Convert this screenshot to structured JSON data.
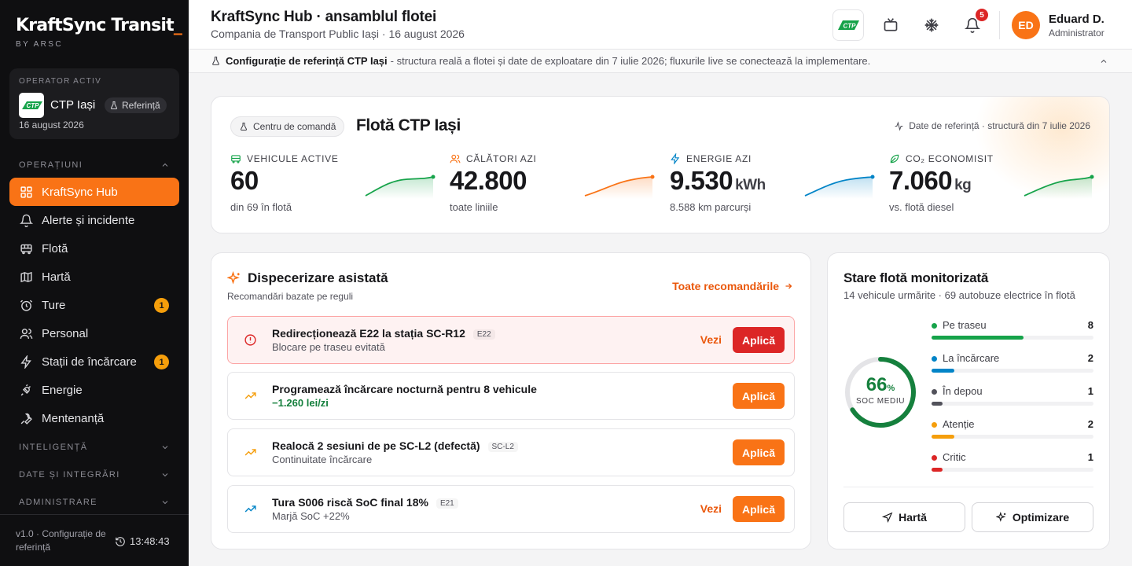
{
  "brand": {
    "title": "KraftSync Transit",
    "cursor": "_",
    "subtitle": "BY ARSC"
  },
  "operator": {
    "label": "OPERATOR ACTIV",
    "name": "CTP Iași",
    "badge": "Referință",
    "date": "16 august 2026"
  },
  "sidebar": {
    "section_ops": "OPERAȚIUNI",
    "items": [
      {
        "label": "KraftSync Hub",
        "icon": "grid-icon",
        "active": true
      },
      {
        "label": "Alerte și incidente",
        "icon": "bell-icon"
      },
      {
        "label": "Flotă",
        "icon": "bus-icon"
      },
      {
        "label": "Hartă",
        "icon": "map-icon"
      },
      {
        "label": "Ture",
        "icon": "clock-icon",
        "badge": "1"
      },
      {
        "label": "Personal",
        "icon": "users-icon"
      },
      {
        "label": "Stații de încărcare",
        "icon": "bolt-icon",
        "badge": "1"
      },
      {
        "label": "Energie",
        "icon": "plug-icon"
      },
      {
        "label": "Mentenanță",
        "icon": "wrench-icon"
      }
    ],
    "section_intel": "INTELIGENȚĂ",
    "section_data": "DATE ȘI INTEGRĂRI",
    "section_admin": "ADMINISTRARE",
    "footer_version": "v1.0 · Configurație de referință",
    "footer_time": "13:48:43"
  },
  "topbar": {
    "title": "KraftSync Hub · ansamblul flotei",
    "subtitle": "Compania de Transport Public Iași · 16 august 2026",
    "notifications": "5",
    "avatar_initials": "ED",
    "user_name": "Eduard D.",
    "user_role": "Administrator"
  },
  "banner": {
    "bold": "Configurație de referință CTP Iași",
    "text": "- structura reală a flotei și date de exploatare din 7 iulie 2026; fluxurile live se conectează la implementare."
  },
  "hero": {
    "pill": "Centru de comandă",
    "title": "Flotă CTP Iași",
    "date": "Date de referință · structură din 7 iulie 2026",
    "kpis": [
      {
        "label": "VEHICULE ACTIVE",
        "value": "60",
        "unit": "",
        "sub": "din 69 în flotă",
        "color": "#16a34a"
      },
      {
        "label": "CĂLĂTORI AZI",
        "value": "42.800",
        "unit": "",
        "sub": "toate liniile",
        "color": "#f97316"
      },
      {
        "label": "ENERGIE AZI",
        "value": "9.530",
        "unit": "kWh",
        "sub": "8.588 km parcurși",
        "color": "#0284c7"
      },
      {
        "label": "CO₂ ECONOMISIT",
        "value": "7.060",
        "unit": "kg",
        "sub": "vs. flotă diesel",
        "color": "#16a34a"
      }
    ]
  },
  "dispatch": {
    "title": "Dispecerizare asistată",
    "subtitle": "Recomandări bazate pe reguli",
    "link": "Toate recomandările",
    "items": [
      {
        "title": "Redirecționează E22 la stația SC-R12",
        "tag": "E22",
        "sub": "Blocare pe traseu evitată",
        "vezi": "Vezi",
        "button": "Aplică"
      },
      {
        "title": "Programează încărcare nocturnă pentru 8 vehicule",
        "tag": "",
        "sub": "−1.260 lei/zi",
        "vezi": "",
        "button": "Aplică"
      },
      {
        "title": "Realocă 2 sesiuni de pe SC-L2 (defectă)",
        "tag": "SC-L2",
        "sub": "Continuitate încărcare",
        "vezi": "",
        "button": "Aplică"
      },
      {
        "title": "Tura S006 riscă SoC final 18%",
        "tag": "E21",
        "sub": "Marjă SoC +22%",
        "vezi": "Vezi",
        "button": "Aplică"
      }
    ]
  },
  "fleet": {
    "title": "Stare flotă monitorizată",
    "subtitle": "14 vehicule urmărite · 69 autobuze electrice în flotă",
    "soc_value": "66",
    "soc_unit": "%",
    "soc_label": "SOC MEDIU",
    "soc_fraction": 0.66,
    "statuses": [
      {
        "label": "Pe traseu",
        "count": "8",
        "color": "#16a34a",
        "fraction": 0.57
      },
      {
        "label": "La încărcare",
        "count": "2",
        "color": "#0284c7",
        "fraction": 0.14
      },
      {
        "label": "În depou",
        "count": "1",
        "color": "#52525b",
        "fraction": 0.07
      },
      {
        "label": "Atenție",
        "count": "2",
        "color": "#f59e0b",
        "fraction": 0.14
      },
      {
        "label": "Critic",
        "count": "1",
        "color": "#dc2626",
        "fraction": 0.07
      }
    ],
    "map_button": "Hartă",
    "optimize_button": "Optimizare"
  }
}
